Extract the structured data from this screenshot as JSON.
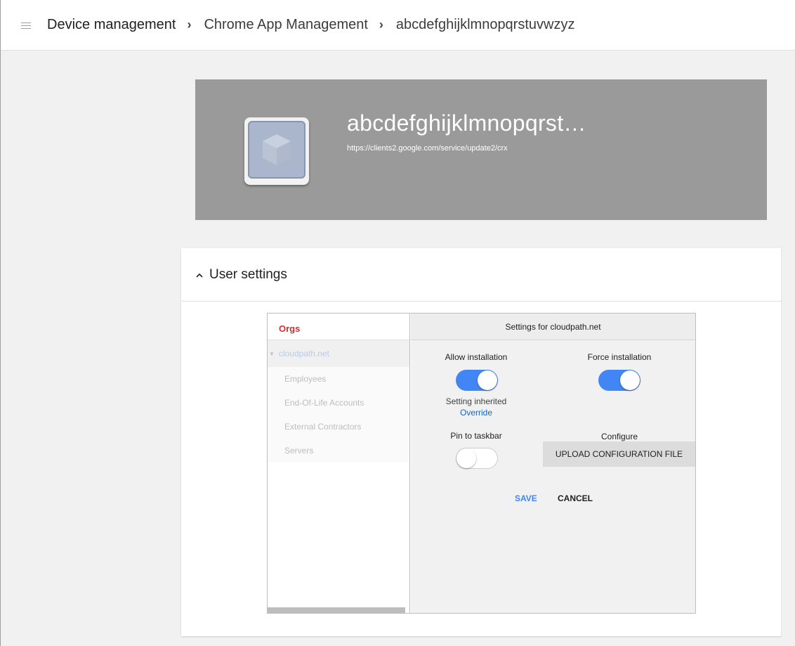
{
  "breadcrumb": {
    "items": [
      "Device management",
      "Chrome App Management",
      "abcdefghijklmnopqrstuvwzyz"
    ],
    "separator": "›"
  },
  "app": {
    "title": "abcdefghijklmnopqrst…",
    "url": "https://clients2.google.com/service/update2/crx"
  },
  "section": {
    "title": "User settings"
  },
  "orgs": {
    "title": "Orgs",
    "root": "cloudpath.net",
    "children": [
      "Employees",
      "End-Of-Life Accounts",
      "External Contractors",
      "Servers"
    ]
  },
  "settings": {
    "header": "Settings for cloudpath.net",
    "allow_installation": {
      "label": "Allow installation",
      "enabled": true
    },
    "inherited_text": "Setting inherited",
    "override_link": "Override",
    "force_installation": {
      "label": "Force installation",
      "enabled": true
    },
    "pin_to_taskbar": {
      "label": "Pin to taskbar",
      "enabled": false
    },
    "configure": {
      "label": "Configure",
      "button": "UPLOAD CONFIGURATION FILE"
    },
    "save_label": "SAVE",
    "cancel_label": "CANCEL"
  },
  "colors": {
    "accent": "#4285f4",
    "orgs_title": "#d32f2f",
    "banner": "#9a9a9a"
  }
}
